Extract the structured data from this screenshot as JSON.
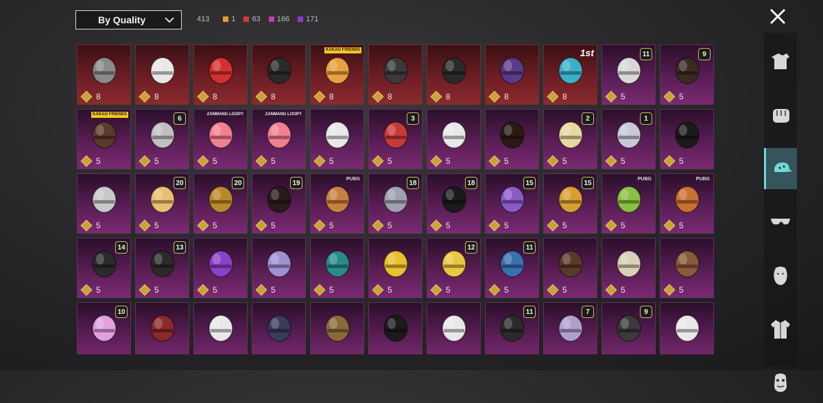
{
  "toolbar": {
    "sort_label": "By Quality",
    "total": "413",
    "counts": [
      {
        "value": "1",
        "color": "#e0a028"
      },
      {
        "value": "63",
        "color": "#d43a3a"
      },
      {
        "value": "166",
        "color": "#c83aa8"
      },
      {
        "value": "171",
        "color": "#8a3ad0"
      }
    ]
  },
  "close_icon": "close-icon",
  "items": [
    {
      "pts": "8",
      "q": "red",
      "art": "mask-helmet",
      "c": "#8a8a8a"
    },
    {
      "pts": "8",
      "q": "red",
      "art": "chicken-mask",
      "c": "#e8e8e8"
    },
    {
      "pts": "8",
      "q": "red",
      "art": "flower-hat",
      "c": "#d43030"
    },
    {
      "pts": "8",
      "q": "red",
      "art": "pirate-hat",
      "c": "#2a2a2a"
    },
    {
      "pts": "8",
      "q": "red",
      "art": "ryan-head",
      "c": "#e8a040",
      "tag": "KAKAO FRIENDS",
      "tagType": "kakao"
    },
    {
      "pts": "8",
      "q": "red",
      "art": "black-helmet",
      "c": "#3a3a3a"
    },
    {
      "pts": "8",
      "q": "red",
      "art": "anubis-mask",
      "c": "#2a2a2a"
    },
    {
      "pts": "8",
      "q": "red",
      "art": "galaxy-helmet",
      "c": "#5a3a8a"
    },
    {
      "pts": "8",
      "q": "red",
      "art": "racing-helmet",
      "c": "#3ab0c8",
      "first": "1st"
    },
    {
      "pts": "5",
      "q": "pink",
      "art": "white-wig",
      "c": "#d8d8d8",
      "lvl": "11"
    },
    {
      "pts": "5",
      "q": "pink",
      "art": "dark-hair",
      "c": "#3a2a22",
      "lvl": "9"
    },
    {
      "pts": "5",
      "q": "pink",
      "art": "headphones-hair",
      "c": "#5a3a2a",
      "tag": "KAKAO FRIENDS",
      "tagType": "kakao"
    },
    {
      "pts": "5",
      "q": "pink",
      "art": "warrior-helmet",
      "c": "#c0c0c0",
      "lvl": "6"
    },
    {
      "pts": "5",
      "q": "pink",
      "art": "loopy-head",
      "c": "#f08090",
      "tag": "ZANMANG LOOPY",
      "tagType": "loopy"
    },
    {
      "pts": "5",
      "q": "pink",
      "art": "loopy-head",
      "c": "#f08090",
      "tag": "ZANMANG LOOPY",
      "tagType": "loopy"
    },
    {
      "pts": "5",
      "q": "pink",
      "art": "white-braid",
      "c": "#e8e8e8"
    },
    {
      "pts": "5",
      "q": "pink",
      "art": "jester-hat",
      "c": "#c83a3a",
      "lvl": "3"
    },
    {
      "pts": "5",
      "q": "pink",
      "art": "bunny-mask",
      "c": "#e8e8e8"
    },
    {
      "pts": "5",
      "q": "pink",
      "art": "bow-hair",
      "c": "#2a1a12"
    },
    {
      "pts": "5",
      "q": "pink",
      "art": "blonde-cap",
      "c": "#e8d8a0",
      "lvl": "2"
    },
    {
      "pts": "5",
      "q": "pink",
      "art": "silver-bun",
      "c": "#c8c8d8",
      "lvl": "1"
    },
    {
      "pts": "5",
      "q": "pink",
      "art": "dreadlocks",
      "c": "#1a1a1a"
    },
    {
      "pts": "5",
      "q": "pink",
      "art": "silver-hair",
      "c": "#c8c8c8"
    },
    {
      "pts": "5",
      "q": "pink",
      "art": "bunny-ears-hair",
      "c": "#e8c070",
      "lvl": "20"
    },
    {
      "pts": "5",
      "q": "pink",
      "art": "gold-helmet",
      "c": "#b88a2a",
      "lvl": "20"
    },
    {
      "pts": "5",
      "q": "pink",
      "art": "red-bun",
      "c": "#2a1a1a",
      "lvl": "19"
    },
    {
      "pts": "5",
      "q": "pink",
      "art": "potato-head",
      "c": "#c88040",
      "tag": "PUBG",
      "tagType": "pubg"
    },
    {
      "pts": "5",
      "q": "pink",
      "art": "silver-braid",
      "c": "#a0a0b0",
      "lvl": "18"
    },
    {
      "pts": "5",
      "q": "pink",
      "art": "dark-bob",
      "c": "#1a1a1a",
      "lvl": "18"
    },
    {
      "pts": "5",
      "q": "pink",
      "art": "bird-mask",
      "c": "#8a5ac8",
      "lvl": "15"
    },
    {
      "pts": "5",
      "q": "pink",
      "art": "gold-mask",
      "c": "#d8a030",
      "lvl": "15"
    },
    {
      "pts": "5",
      "q": "pink",
      "art": "octopus-head",
      "c": "#8ac040",
      "tag": "PUBG",
      "tagType": "pubg"
    },
    {
      "pts": "5",
      "q": "pink",
      "art": "snake-head",
      "c": "#c87030",
      "tag": "PUBG",
      "tagType": "pubg"
    },
    {
      "pts": "5",
      "q": "pink",
      "art": "bandana-hair",
      "c": "#2a2a2a",
      "lvl": "14"
    },
    {
      "pts": "5",
      "q": "pink",
      "art": "devil-cap",
      "c": "#2a2a2a",
      "lvl": "13"
    },
    {
      "pts": "5",
      "q": "pink",
      "art": "purple-helmet",
      "c": "#8a40c8"
    },
    {
      "pts": "5",
      "q": "pink",
      "art": "lavender-bun",
      "c": "#a090d0"
    },
    {
      "pts": "5",
      "q": "pink",
      "art": "teal-hood",
      "c": "#2a8a8a"
    },
    {
      "pts": "5",
      "q": "pink",
      "art": "duck-mask",
      "c": "#e8c030"
    },
    {
      "pts": "5",
      "q": "pink",
      "art": "yellow-can",
      "c": "#e8c840",
      "lvl": "12"
    },
    {
      "pts": "5",
      "q": "pink",
      "art": "blue-cap",
      "c": "#3a70b0",
      "lvl": "11"
    },
    {
      "pts": "5",
      "q": "pink",
      "art": "cowboy-hat",
      "c": "#5a3a2a"
    },
    {
      "pts": "5",
      "q": "pink",
      "art": "white-turban",
      "c": "#d8d0b8"
    },
    {
      "pts": "5",
      "q": "pink",
      "art": "gas-mask",
      "c": "#8a5a3a"
    },
    {
      "pts": "",
      "q": "pink",
      "art": "pink-helmet",
      "c": "#e0a0e0",
      "lvl": "10"
    },
    {
      "pts": "",
      "q": "pink",
      "art": "red-mask",
      "c": "#8a2a2a"
    },
    {
      "pts": "",
      "q": "pink",
      "art": "bunny-hood",
      "c": "#e8e8e8"
    },
    {
      "pts": "",
      "q": "pink",
      "art": "navy-helmet",
      "c": "#3a3a5a"
    },
    {
      "pts": "",
      "q": "pink",
      "art": "wood-crown",
      "c": "#8a6a3a"
    },
    {
      "pts": "",
      "q": "pink",
      "art": "black-hood",
      "c": "#1a1a1a"
    },
    {
      "pts": "",
      "q": "pink",
      "art": "wrapped-hood",
      "c": "#e8e8e8"
    },
    {
      "pts": "",
      "q": "pink",
      "art": "eye-patch-hat",
      "c": "#2a2a2a",
      "lvl": "11"
    },
    {
      "pts": "",
      "q": "pink",
      "art": "crown-turban",
      "c": "#b0a0d0",
      "lvl": "7"
    },
    {
      "pts": "",
      "q": "pink",
      "art": "spike-helmet",
      "c": "#3a3a3a",
      "lvl": "9"
    },
    {
      "pts": "",
      "q": "pink",
      "art": "top-hat",
      "c": "#e8e8e8"
    }
  ],
  "sidebar": [
    {
      "name": "outfit-icon",
      "active": false
    },
    {
      "name": "fist-icon",
      "active": false
    },
    {
      "name": "cap-icon",
      "active": true
    },
    {
      "name": "sunglasses-icon",
      "active": false
    },
    {
      "name": "face-icon",
      "active": false
    },
    {
      "name": "jacket-icon",
      "active": false
    },
    {
      "name": "gloves-icon",
      "active": false
    }
  ]
}
